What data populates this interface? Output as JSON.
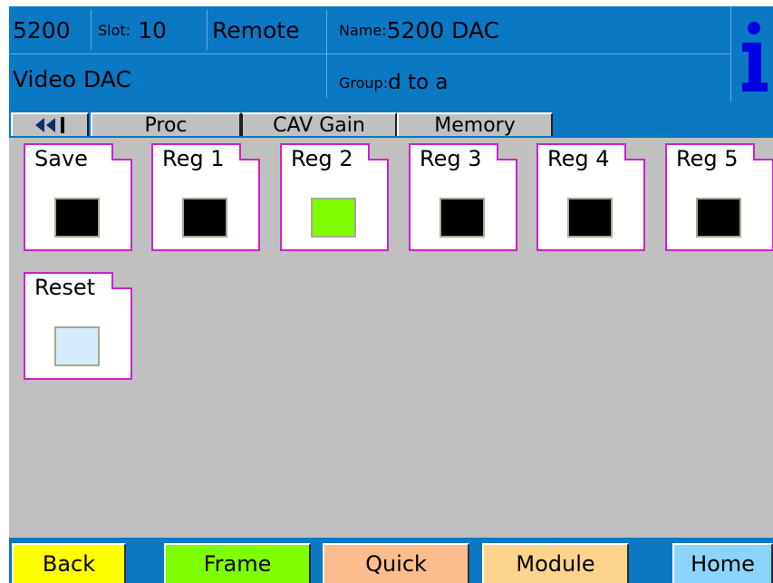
{
  "header": {
    "model": "5200",
    "slot_label": "Slot:",
    "slot_value": "10",
    "mode": "Remote",
    "name_label": "Name:",
    "name_value": "5200 DAC",
    "module_type": "Video DAC",
    "group_label": "Group:",
    "group_value": "d to a",
    "info_icon": "info-icon"
  },
  "tabs": {
    "back_icon": "double-left-arrow-icon",
    "items": [
      {
        "label": "Proc",
        "active": false
      },
      {
        "label": "CAV Gain",
        "active": true
      },
      {
        "label": "Memory",
        "active": false
      }
    ]
  },
  "registers": [
    {
      "label": "Save",
      "color": "#000000"
    },
    {
      "label": "Reg 1",
      "color": "#000000"
    },
    {
      "label": "Reg 2",
      "color": "#80ff00"
    },
    {
      "label": "Reg 3",
      "color": "#000000"
    },
    {
      "label": "Reg 4",
      "color": "#000000"
    },
    {
      "label": "Reg 5",
      "color": "#000000"
    },
    {
      "label": "Reset",
      "color": "#d4ecfc"
    }
  ],
  "bottom_buttons": [
    {
      "label": "Back",
      "color": "#ffff00"
    },
    {
      "label": "Frame",
      "color": "#80ff00"
    },
    {
      "label": "Quick",
      "color": "#fcbc8c"
    },
    {
      "label": "Module",
      "color": "#fcd48c"
    },
    {
      "label": "Home",
      "color": "#8cd4fc"
    }
  ],
  "colors": {
    "header_bg": "#0b78c4",
    "body_bg": "#c0c0c0",
    "tile_border": "#cc22cc"
  }
}
